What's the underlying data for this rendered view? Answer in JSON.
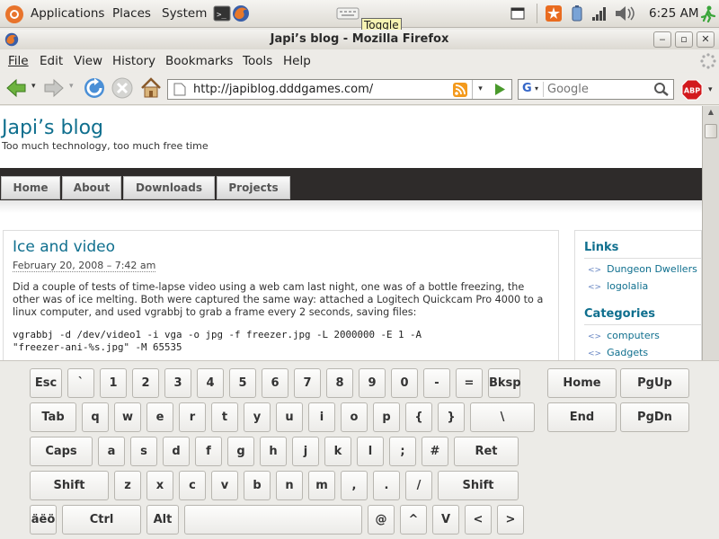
{
  "panel": {
    "applications": "Applications",
    "places": "Places",
    "system": "System",
    "tooltip": "Toggle",
    "clock": "6:25 AM"
  },
  "window": {
    "title": "Japi’s blog - Mozilla Firefox"
  },
  "menu": [
    "File",
    "Edit",
    "View",
    "History",
    "Bookmarks",
    "Tools",
    "Help"
  ],
  "navigation": {
    "url": "http://japiblog.dddgames.com/",
    "search_placeholder": "Google",
    "search_engine": "G"
  },
  "blog": {
    "title": "Japi’s blog",
    "subtitle": "Too much technology, too much free time",
    "tabs": [
      "Home",
      "About",
      "Downloads",
      "Projects"
    ],
    "post": {
      "title": "Ice and video",
      "date": "February 20, 2008 – 7:42 am",
      "body": "Did a couple of tests of time-lapse video using a web cam last night, one was of a bottle freezing, the other was of ice melting. Both were captured the same way: attached a Logitech Quickcam Pro 4000 to a linux computer, and used vgrabbj to grab a frame every 2 seconds, saving files:",
      "code": "vgrabbj -d /dev/video1 -i vga -o jpg -f freezer.jpg -L 2000000 -E 1 -A\n\"freezer-ani-%s.jpg\" -M 65535"
    },
    "sidebar": {
      "links_heading": "Links",
      "links": [
        "Dungeon Dwellers",
        "logolalia"
      ],
      "categories_heading": "Categories",
      "categories": [
        "computers",
        "Gadgets"
      ]
    }
  },
  "keyboard": {
    "row1": [
      "Esc",
      "`",
      "1",
      "2",
      "3",
      "4",
      "5",
      "6",
      "7",
      "8",
      "9",
      "0",
      "-",
      "=",
      "Bksp"
    ],
    "row2": [
      "Tab",
      "q",
      "w",
      "e",
      "r",
      "t",
      "y",
      "u",
      "i",
      "o",
      "p",
      "{",
      "}",
      "\\"
    ],
    "row3": [
      "Caps",
      "a",
      "s",
      "d",
      "f",
      "g",
      "h",
      "j",
      "k",
      "l",
      ";",
      "#",
      "Ret"
    ],
    "row4": [
      "Shift",
      "z",
      "x",
      "c",
      "v",
      "b",
      "n",
      "m",
      ",",
      ".",
      "/",
      "Shift"
    ],
    "row5": [
      "äëö",
      "Ctrl",
      "Alt",
      "",
      "@",
      "^",
      "V",
      "<",
      ">"
    ],
    "nav": [
      "Home",
      "PgUp",
      "End",
      "PgDn"
    ]
  },
  "colors": {
    "link": "#0f6f8e",
    "nav_band": "#2e2b2a",
    "panel_bg": "#e4e1dc"
  },
  "icons": [
    "ubuntu-logo-icon",
    "terminal-icon",
    "firefox-icon",
    "keyboard-icon",
    "window-icon",
    "update-icon",
    "battery-icon",
    "network-icon",
    "volume-icon",
    "logout-icon",
    "back-icon",
    "forward-icon",
    "reload-icon",
    "stop-icon",
    "home-icon",
    "rss-icon",
    "go-icon",
    "search-icon",
    "adblock-icon"
  ]
}
